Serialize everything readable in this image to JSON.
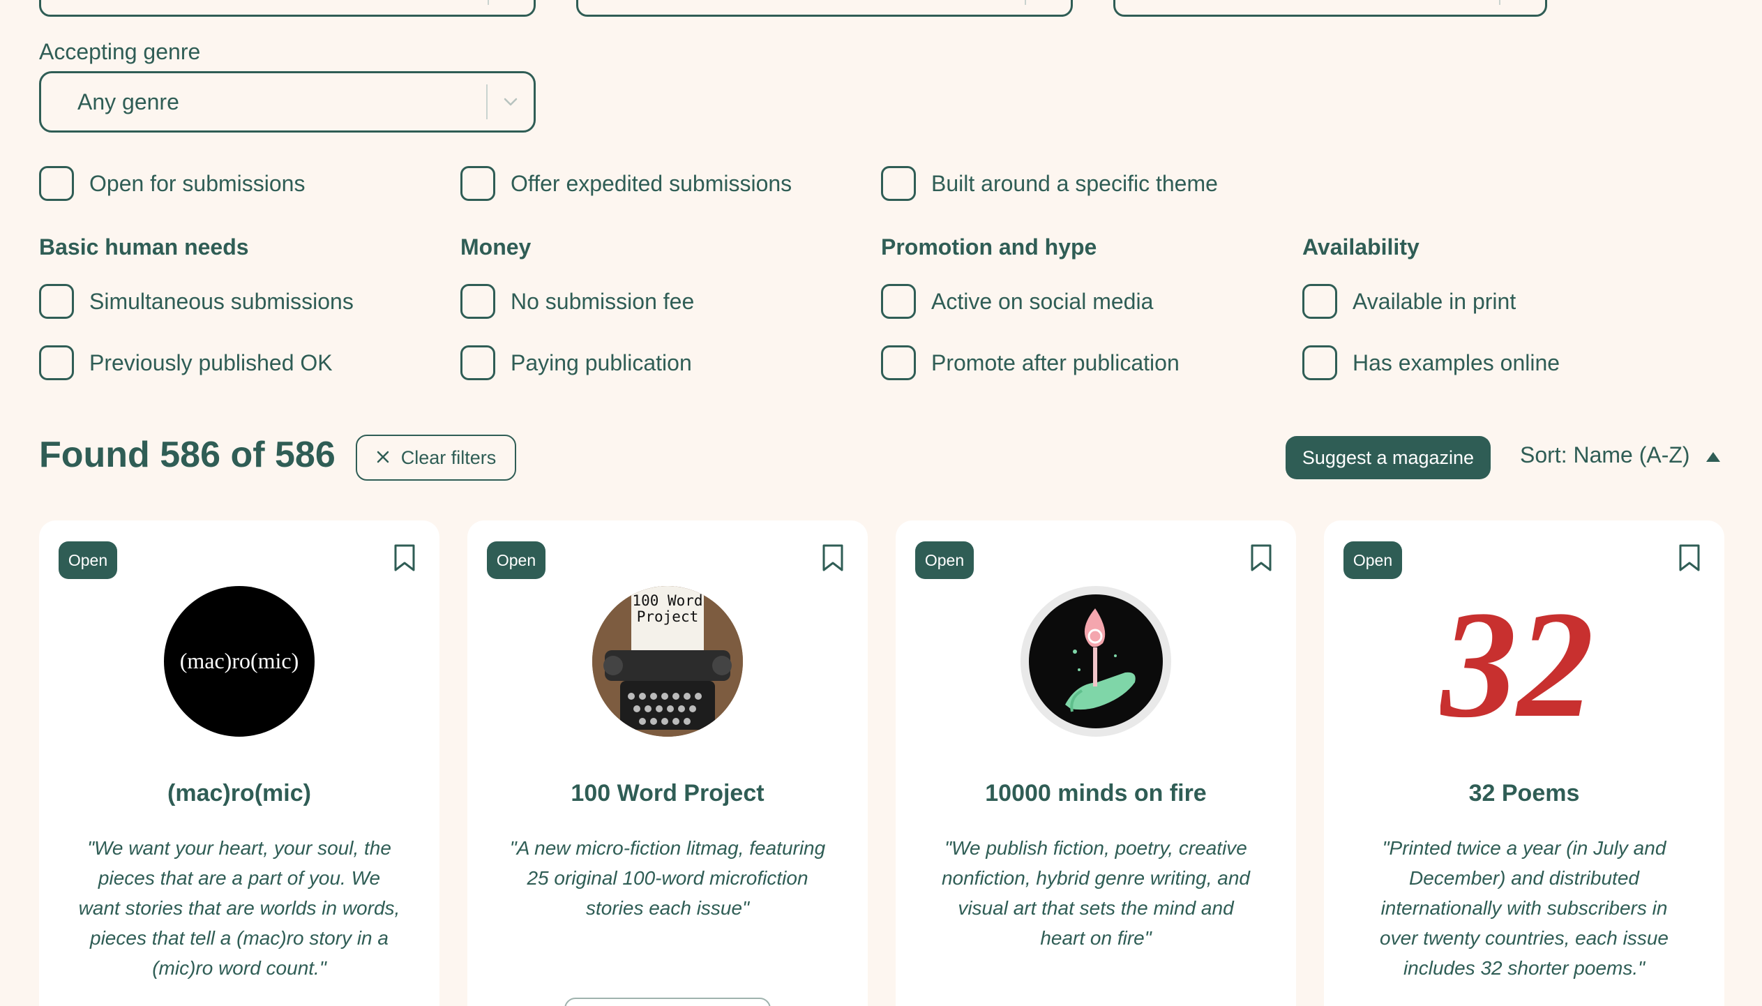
{
  "filters": {
    "genre_label": "Accepting genre",
    "genre_value": "Any genre",
    "toggles": [
      {
        "label": "Open for submissions",
        "checked": false
      },
      {
        "label": "Offer expedited submissions",
        "checked": false
      },
      {
        "label": "Built around a specific theme",
        "checked": false
      }
    ],
    "groups": [
      {
        "heading": "Basic human needs",
        "options": [
          "Simultaneous submissions",
          "Previously published OK"
        ]
      },
      {
        "heading": "Money",
        "options": [
          "No submission fee",
          "Paying publication"
        ]
      },
      {
        "heading": "Promotion and hype",
        "options": [
          "Active on social media",
          "Promote after publication"
        ]
      },
      {
        "heading": "Availability",
        "options": [
          "Available in print",
          "Has examples online"
        ]
      }
    ]
  },
  "results": {
    "found_text": "Found 586 of 586",
    "clear_label": "Clear filters",
    "suggest_label": "Suggest a magazine",
    "sort_label": "Sort: Name (A-Z)"
  },
  "cards": [
    {
      "status": "Open",
      "title": "(mac)ro(mic)",
      "logo_text": "(mac)ro(mic)",
      "description": "\"We want your heart, your soul, the pieces that are a part of you. We want stories that are worlds in words, pieces that tell a (mac)ro story in a (mic)ro word count.\""
    },
    {
      "status": "Open",
      "title": "100 Word Project",
      "logo_text": "100 Word Project",
      "description": "\"A new micro-fiction litmag, featuring 25 original 100-word microfiction stories each issue\""
    },
    {
      "status": "Open",
      "title": "10000 minds on fire",
      "logo_text": "",
      "description": "\"We publish fiction, poetry, creative nonfiction, hybrid genre writing, and visual art that sets the mind and heart on fire\""
    },
    {
      "status": "Open",
      "title": "32 Poems",
      "logo_text": "32",
      "description": "\"Printed twice a year (in July and December) and distributed internationally with subscribers in over twenty countries, each issue includes 32 shorter poems.\""
    }
  ],
  "colors": {
    "accent": "#2f5d55",
    "background": "#fdf6f0",
    "logo_red": "#c8302f"
  }
}
